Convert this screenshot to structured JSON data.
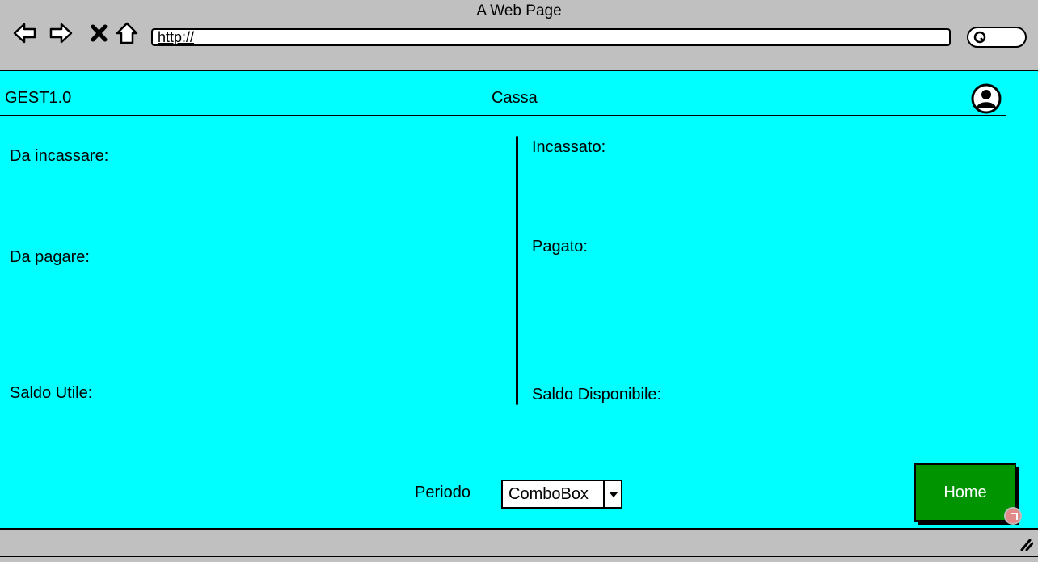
{
  "browser": {
    "title": "A Web Page",
    "url": "http://",
    "icons": [
      "back-arrow-icon",
      "forward-arrow-icon",
      "close-x-icon",
      "home-icon",
      "search-icon"
    ]
  },
  "header": {
    "app_name": "GEST1.0",
    "page_title": "Cassa",
    "avatar_icon": "user-circle-icon"
  },
  "left_column": {
    "da_incassare": "Da incassare:",
    "da_pagare": "Da pagare:",
    "saldo_utile": "Saldo Utile:"
  },
  "right_column": {
    "incassato": "Incassato:",
    "pagato": "Pagato:",
    "saldo_disponibile": "Saldo Disponibile:"
  },
  "footer": {
    "periodo_label": "Periodo",
    "combo_value": "ComboBox",
    "home_button": "Home"
  },
  "colors": {
    "content_background": "#00ffff",
    "home_button": "#009400",
    "chrome": "#c0c0c0"
  }
}
